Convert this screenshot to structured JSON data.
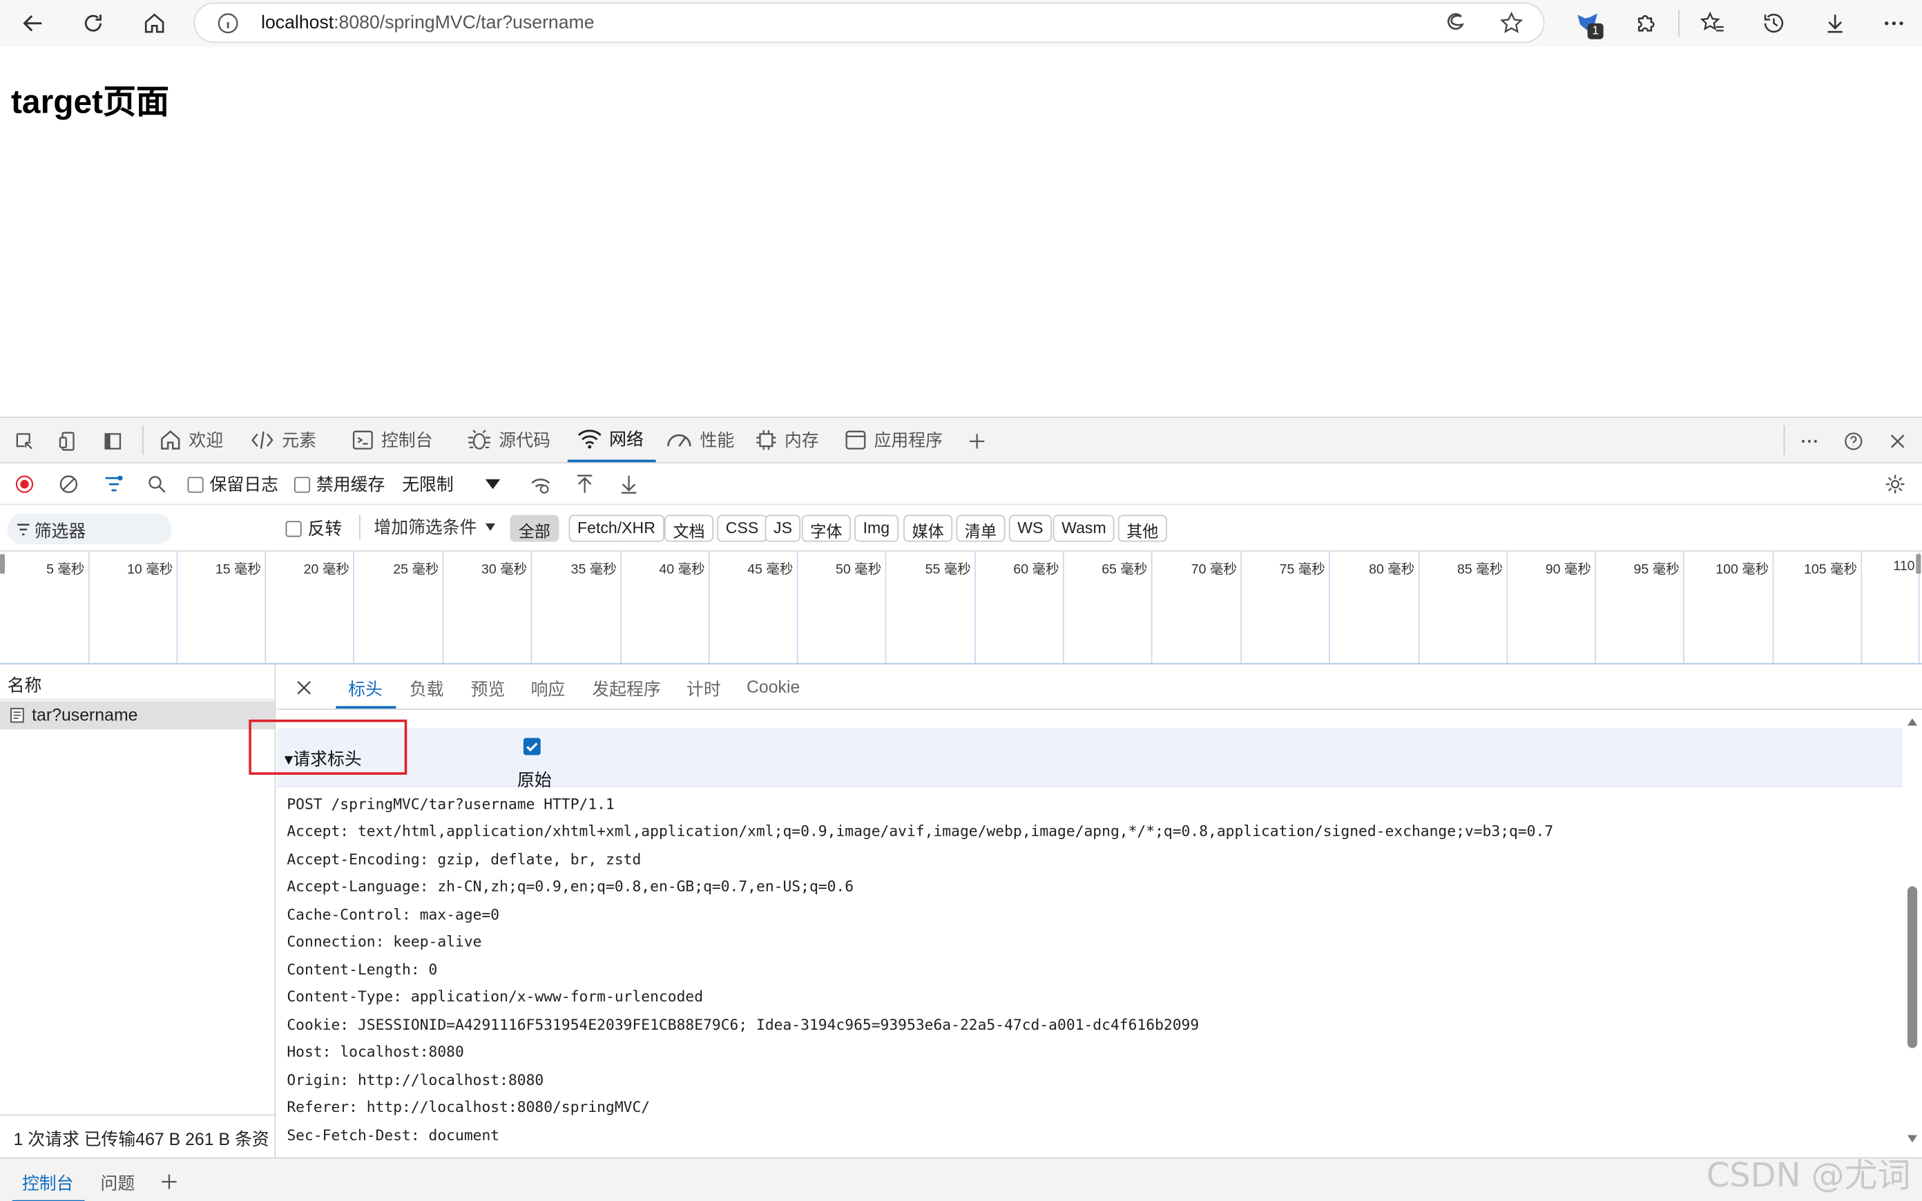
{
  "browser": {
    "url_host": "localhost",
    "url_rest": ":8080/springMVC/tar?username",
    "notification_count": "1"
  },
  "page": {
    "title": "target页面"
  },
  "devtools": {
    "tabs": [
      "欢迎",
      "元素",
      "控制台",
      "源代码",
      "网络",
      "性能",
      "内存",
      "应用程序"
    ],
    "active_tab": "网络",
    "toolbar": {
      "preserve_log": "保留日志",
      "disable_cache": "禁用缓存",
      "throttling": "无限制"
    },
    "filter": {
      "placeholder": "筛选器",
      "invert": "反转",
      "more_filters": "增加筛选条件",
      "chips": [
        "全部",
        "Fetch/XHR",
        "文档",
        "CSS",
        "JS",
        "字体",
        "Img",
        "媒体",
        "清单",
        "WS",
        "Wasm",
        "其他"
      ]
    },
    "timeline": [
      "5 毫秒",
      "10 毫秒",
      "15 毫秒",
      "20 毫秒",
      "25 毫秒",
      "30 毫秒",
      "35 毫秒",
      "40 毫秒",
      "45 毫秒",
      "50 毫秒",
      "55 毫秒",
      "60 毫秒",
      "65 毫秒",
      "70 毫秒",
      "75 毫秒",
      "80 毫秒",
      "85 毫秒",
      "90 毫秒",
      "95 毫秒",
      "100 毫秒",
      "105 毫秒",
      "110"
    ],
    "requests": {
      "column": "名称",
      "rows": [
        "tar?username"
      ],
      "status": "1 次请求   已传输467 B   261 B 条资"
    },
    "detail": {
      "tabs": [
        "标头",
        "负载",
        "预览",
        "响应",
        "发起程序",
        "计时",
        "Cookie"
      ],
      "active": "标头",
      "section_title": "▾请求标头",
      "raw_label": "原始",
      "raw_checked": true,
      "header_lines": [
        "POST /springMVC/tar?username HTTP/1.1",
        "Accept: text/html,application/xhtml+xml,application/xml;q=0.9,image/avif,image/webp,image/apng,*/*;q=0.8,application/signed-exchange;v=b3;q=0.7",
        "Accept-Encoding: gzip, deflate, br, zstd",
        "Accept-Language: zh-CN,zh;q=0.9,en;q=0.8,en-GB;q=0.7,en-US;q=0.6",
        "Cache-Control: max-age=0",
        "Connection: keep-alive",
        "Content-Length: 0",
        "Content-Type: application/x-www-form-urlencoded",
        "Cookie: JSESSIONID=A4291116F531954E2039FE1CB88E79C6; Idea-3194c965=93953e6a-22a5-47cd-a001-dc4f616b2099",
        "Host: localhost:8080",
        "Origin: http://localhost:8080",
        "Referer: http://localhost:8080/springMVC/",
        "Sec-Fetch-Dest: document"
      ]
    },
    "drawer_tabs": [
      "控制台",
      "问题"
    ]
  },
  "watermark": "CSDN @尤词",
  "colors": {
    "accent": "#0f6cbd",
    "highlight_box": "#e0202a",
    "record": "#e0202a"
  }
}
